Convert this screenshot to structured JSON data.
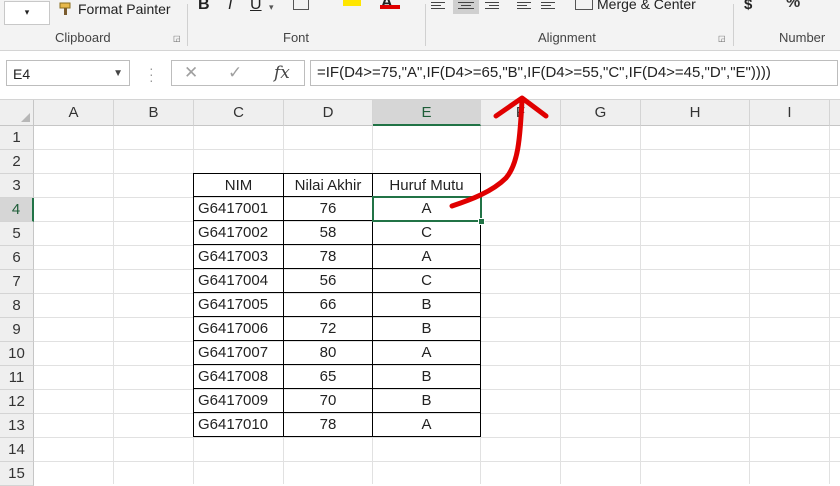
{
  "ribbon": {
    "font_dropdown_label": "▾",
    "format_painter_label": "Format Painter",
    "merge_center_label": "Merge & Center",
    "currency_symbol": "$",
    "groups": {
      "clipboard": "Clipboard",
      "font": "Font",
      "alignment": "Alignment",
      "number": "Number"
    }
  },
  "formula_bar": {
    "name_box": "E4",
    "formula": "=IF(D4>=75,\"A\",IF(D4>=65,\"B\",IF(D4>=55,\"C\",IF(D4>=45,\"D\",\"E\"))))",
    "fx_label": "fx"
  },
  "sheet": {
    "columns": [
      "A",
      "B",
      "C",
      "D",
      "E",
      "F",
      "G",
      "H",
      "I"
    ],
    "rows": [
      "1",
      "2",
      "3",
      "4",
      "5",
      "6",
      "7",
      "8",
      "9",
      "10",
      "11",
      "12",
      "13",
      "14",
      "15"
    ],
    "selected_cell": "E4",
    "table_headers": [
      "NIM",
      "Nilai Akhir",
      "Huruf Mutu"
    ],
    "table_rows": [
      [
        "G6417001",
        "76",
        "A"
      ],
      [
        "G6417002",
        "58",
        "C"
      ],
      [
        "G6417003",
        "78",
        "A"
      ],
      [
        "G6417004",
        "56",
        "C"
      ],
      [
        "G6417005",
        "66",
        "B"
      ],
      [
        "G6417006",
        "72",
        "B"
      ],
      [
        "G6417007",
        "80",
        "A"
      ],
      [
        "G6417008",
        "65",
        "B"
      ],
      [
        "G6417009",
        "70",
        "B"
      ],
      [
        "G6417010",
        "78",
        "A"
      ]
    ]
  },
  "colors": {
    "selection": "#217346",
    "annotation": "#e00000"
  }
}
